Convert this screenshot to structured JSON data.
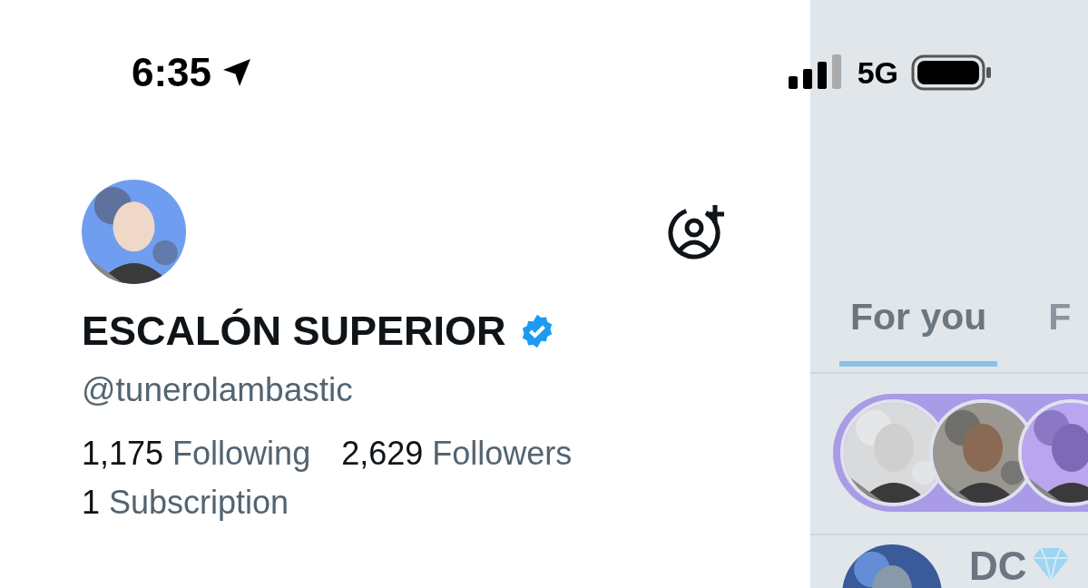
{
  "status_bar": {
    "time": "6:35",
    "network": "5G"
  },
  "drawer": {
    "display_name": "ESCALÓN SUPERIOR",
    "verified": true,
    "handle": "@tunerolambastic",
    "stats": [
      {
        "count": "1,175",
        "label": "Following"
      },
      {
        "count": "2,629",
        "label": "Followers"
      },
      {
        "count": "1",
        "label": "Subscription"
      }
    ]
  },
  "timeline": {
    "tabs": [
      {
        "label": "For you",
        "selected": true
      },
      {
        "label": "F",
        "selected": false
      }
    ],
    "post_author": "DC"
  }
}
